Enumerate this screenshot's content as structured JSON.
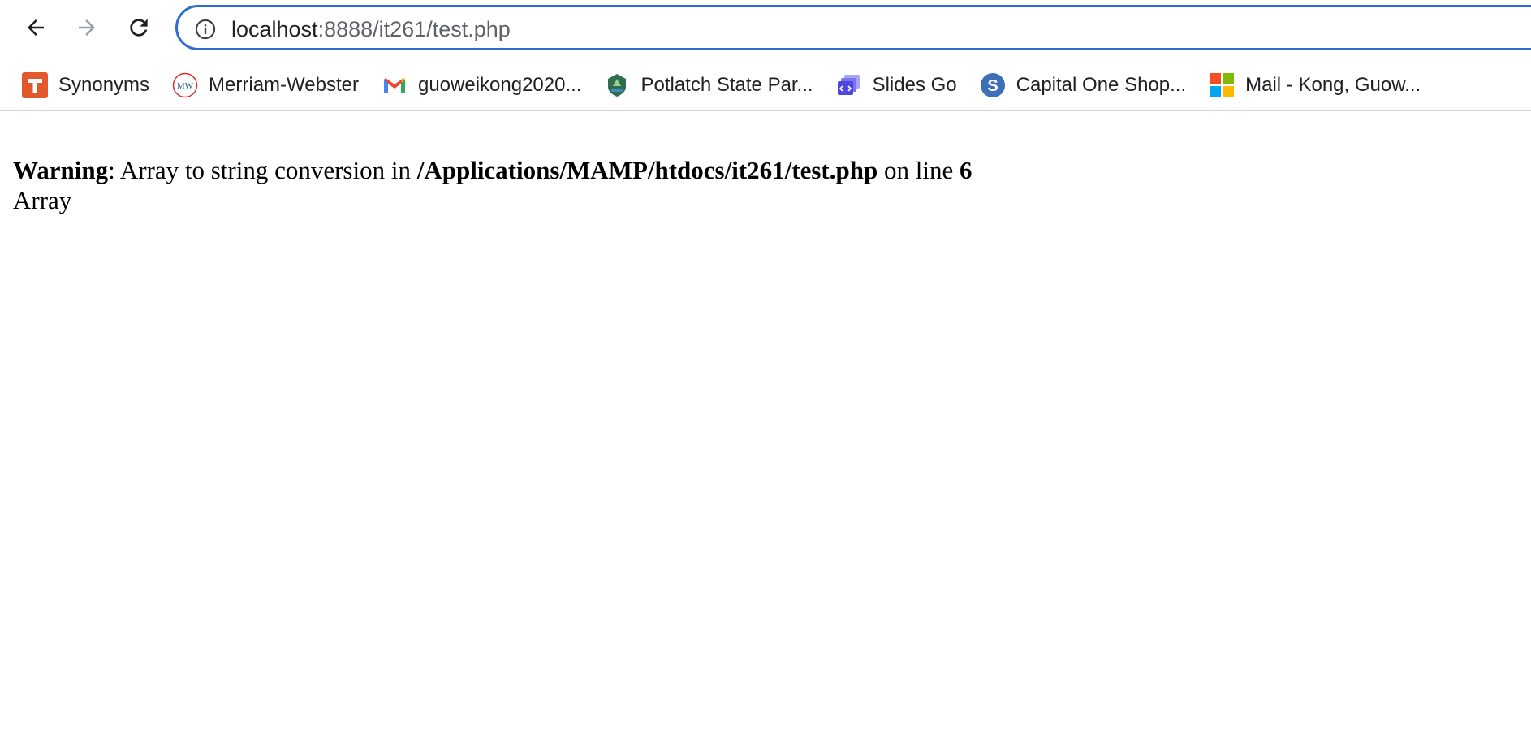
{
  "browser": {
    "url_host": "localhost",
    "url_rest": ":8888/it261/test.php",
    "bookmarks": [
      {
        "label": "Synonyms",
        "icon": "thesaurus-icon"
      },
      {
        "label": "Merriam-Webster",
        "icon": "merriam-webster-icon"
      },
      {
        "label": "guoweikong2020...",
        "icon": "gmail-icon"
      },
      {
        "label": "Potlatch State Par...",
        "icon": "park-icon"
      },
      {
        "label": "Slides Go",
        "icon": "slides-go-icon"
      },
      {
        "label": "Capital One Shop...",
        "icon": "capital-one-shopping-icon"
      },
      {
        "label": "Mail - Kong, Guow...",
        "icon": "microsoft-icon"
      }
    ]
  },
  "page": {
    "warning_label": "Warning",
    "warning_message": ": Array to string conversion in ",
    "file_path": "/Applications/MAMP/htdocs/it261/test.php",
    "on_line_text": " on line ",
    "line_number": "6",
    "output": "Array"
  },
  "colors": {
    "omnibox_border": "#2f6bd1",
    "text": "#202124",
    "url_dim": "#5f6368"
  }
}
